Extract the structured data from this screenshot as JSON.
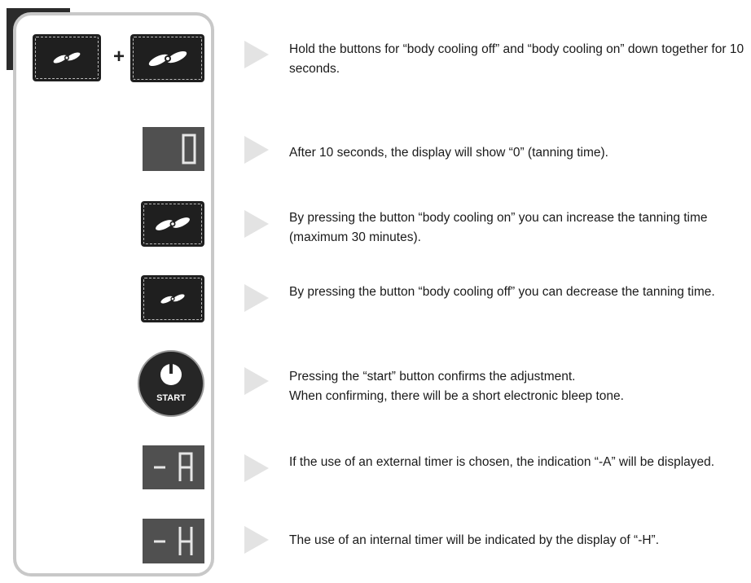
{
  "controls": {
    "plus_sign": "+",
    "start_label": "START",
    "display_zero": "0",
    "display_a": "-A",
    "display_h": "-H"
  },
  "steps": [
    {
      "text": "Hold the buttons for “body cooling off” and “body cooling on” down together for 10 seconds."
    },
    {
      "text": "After 10 seconds, the display will show “0” (tanning time)."
    },
    {
      "text": "By pressing the button “body cooling on” you can increase the tanning time (maximum 30 minutes)."
    },
    {
      "text": "By pressing the button  “body cooling off”  you can decrease the tanning time."
    },
    {
      "line1": "Pressing the “start” button confirms the adjustment.",
      "line2": "When confirming, there will be a short electronic bleep tone."
    },
    {
      "text": "If the use of an external timer is chosen, the indication “-A” will be displayed."
    },
    {
      "text": "The use of an internal timer will be indicated by the display of “-H”."
    }
  ],
  "icons": {
    "fan_small": "fan-icon-small",
    "fan_large": "fan-icon-large",
    "power": "power-icon",
    "arrow": "triangle-arrow-icon"
  },
  "colors": {
    "button_bg": "#1f1f1f",
    "display_bg": "#505050",
    "panel_border": "#c8c8c8",
    "arrow": "#e3e3e3"
  }
}
